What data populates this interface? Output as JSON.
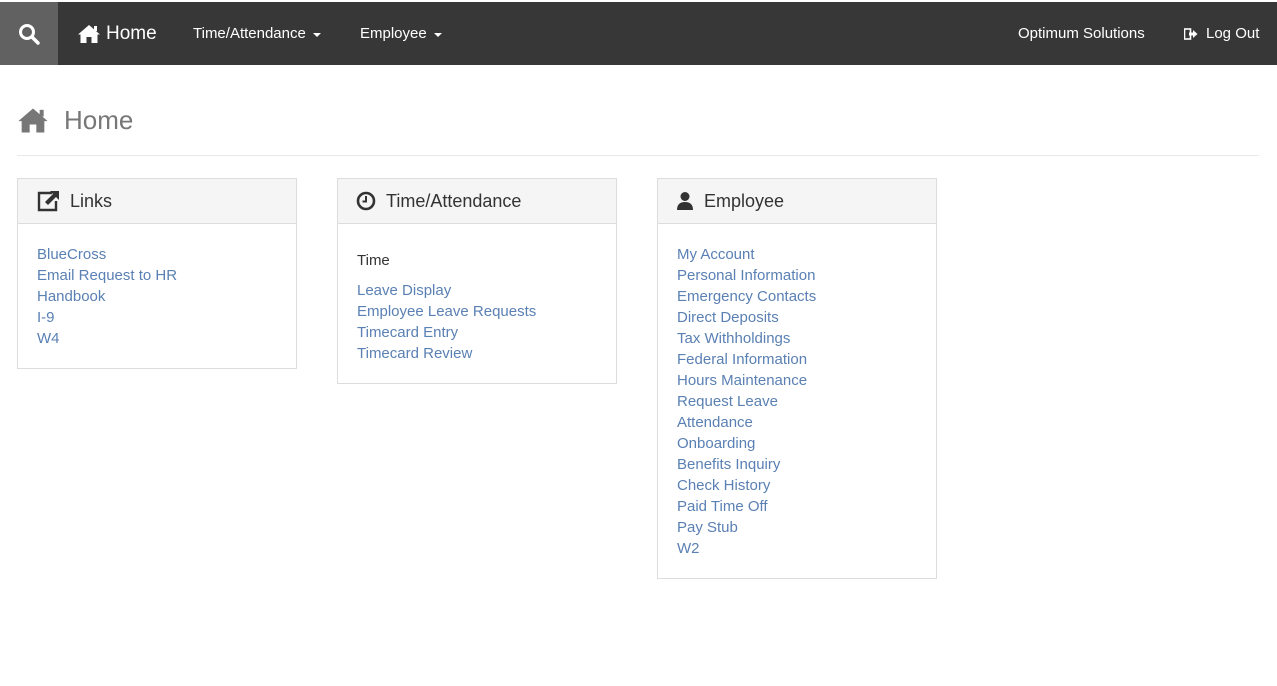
{
  "navbar": {
    "home_label": "Home",
    "time_attendance_label": "Time/Attendance",
    "employee_label": "Employee",
    "company_name": "Optimum Solutions",
    "logout_label": "Log Out"
  },
  "page": {
    "title": "Home"
  },
  "panels": {
    "links": {
      "title": "Links",
      "items": [
        "BlueCross",
        "Email Request to HR",
        "Handbook",
        "I-9",
        "W4"
      ]
    },
    "time_attendance": {
      "title": "Time/Attendance",
      "subheading": "Time",
      "items": [
        "Leave Display",
        "Employee Leave Requests",
        "Timecard Entry",
        "Timecard Review"
      ]
    },
    "employee": {
      "title": "Employee",
      "items": [
        "My Account",
        "Personal Information",
        "Emergency Contacts",
        "Direct Deposits",
        "Tax Withholdings",
        "Federal Information",
        "Hours Maintenance",
        "Request Leave",
        "Attendance",
        "Onboarding",
        "Benefits Inquiry",
        "Check History",
        "Paid Time Off",
        "Pay Stub",
        "W2"
      ]
    }
  },
  "colors": {
    "navbar_bg": "#373737",
    "search_bg": "#616161",
    "link": "#5a80b4",
    "panel_heading_bg": "#f5f5f5"
  }
}
